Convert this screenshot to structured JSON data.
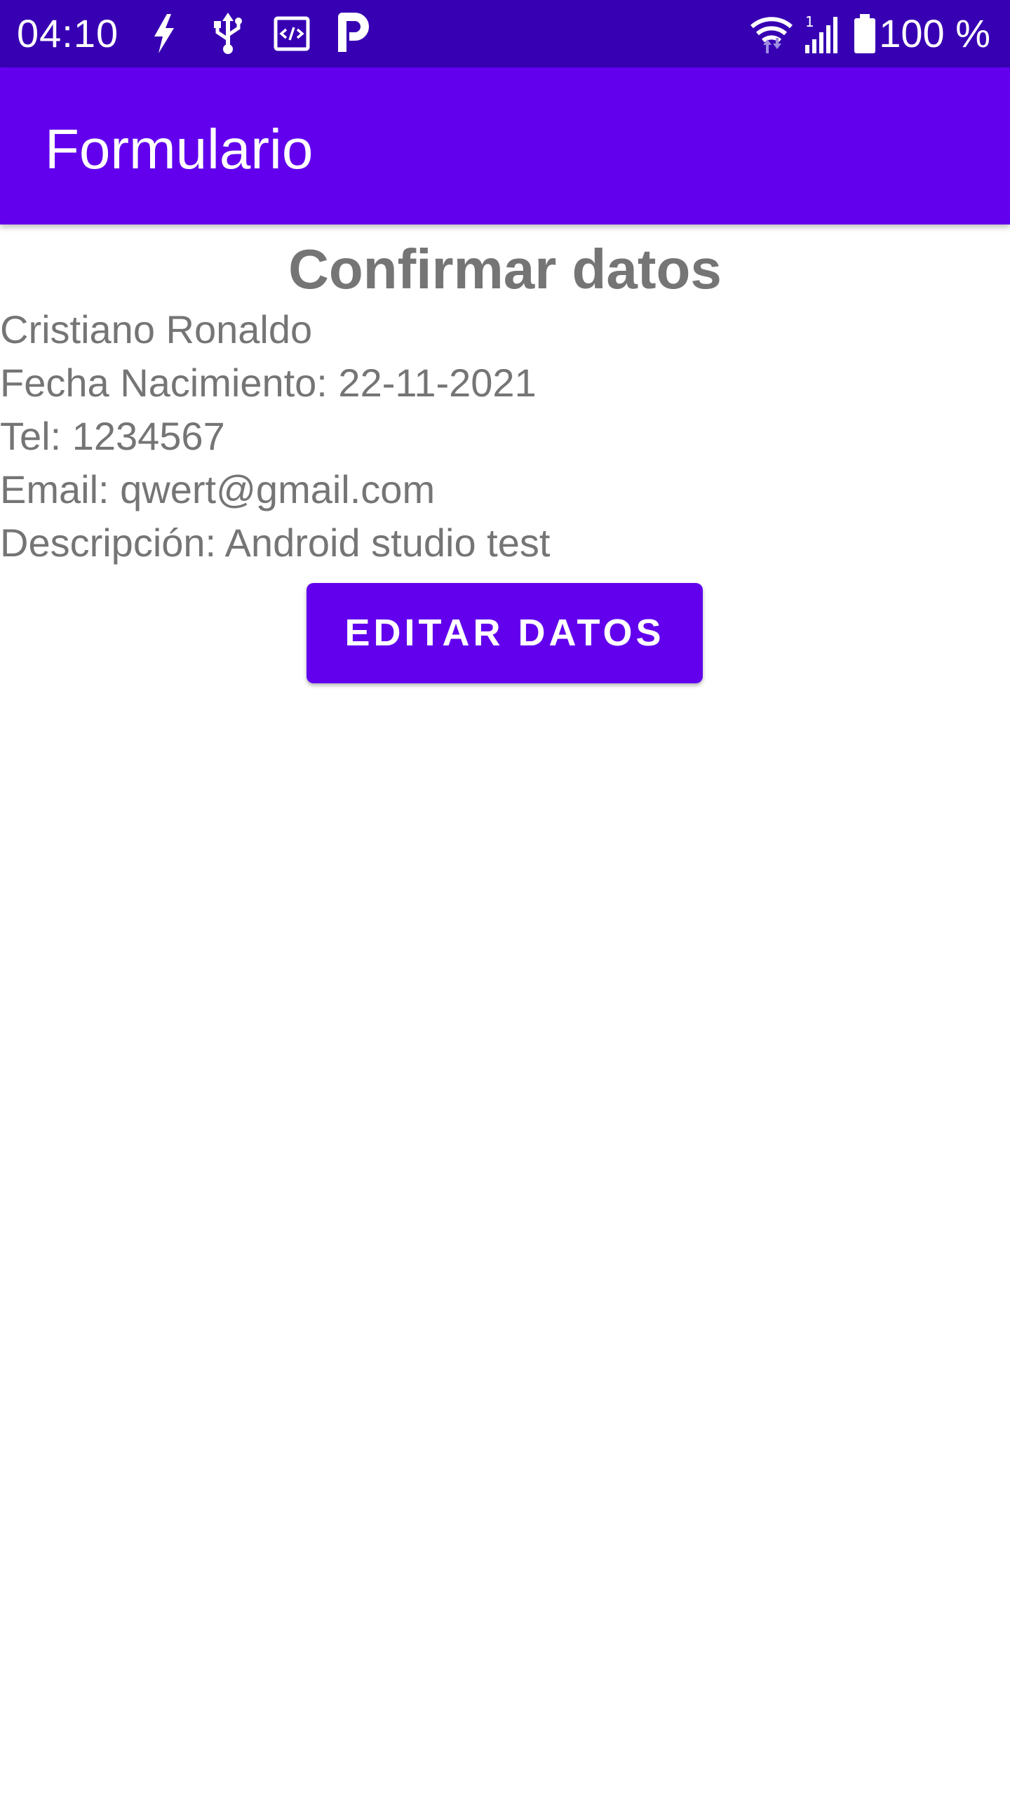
{
  "status_bar": {
    "time": "04:10",
    "battery_text": "100 %",
    "icons_left": [
      "flash-icon",
      "usb-icon",
      "code-icon",
      "parking-icon"
    ],
    "icons_right": [
      "wifi-icon",
      "signal-icon",
      "battery-icon"
    ],
    "background_color": "#3700b3"
  },
  "app_bar": {
    "title": "Formulario",
    "background_color": "#6200ee"
  },
  "main": {
    "heading": "Confirmar datos",
    "name": "Cristiano Ronaldo",
    "birth_date": "Fecha Nacimiento: 22-11-2021",
    "phone": "Tel: 1234567",
    "email": "Email: qwert@gmail.com",
    "description": "Descripción: Android studio test",
    "edit_button_label": "EDITAR DATOS",
    "text_color": "#757575",
    "accent_color": "#6200ee"
  }
}
